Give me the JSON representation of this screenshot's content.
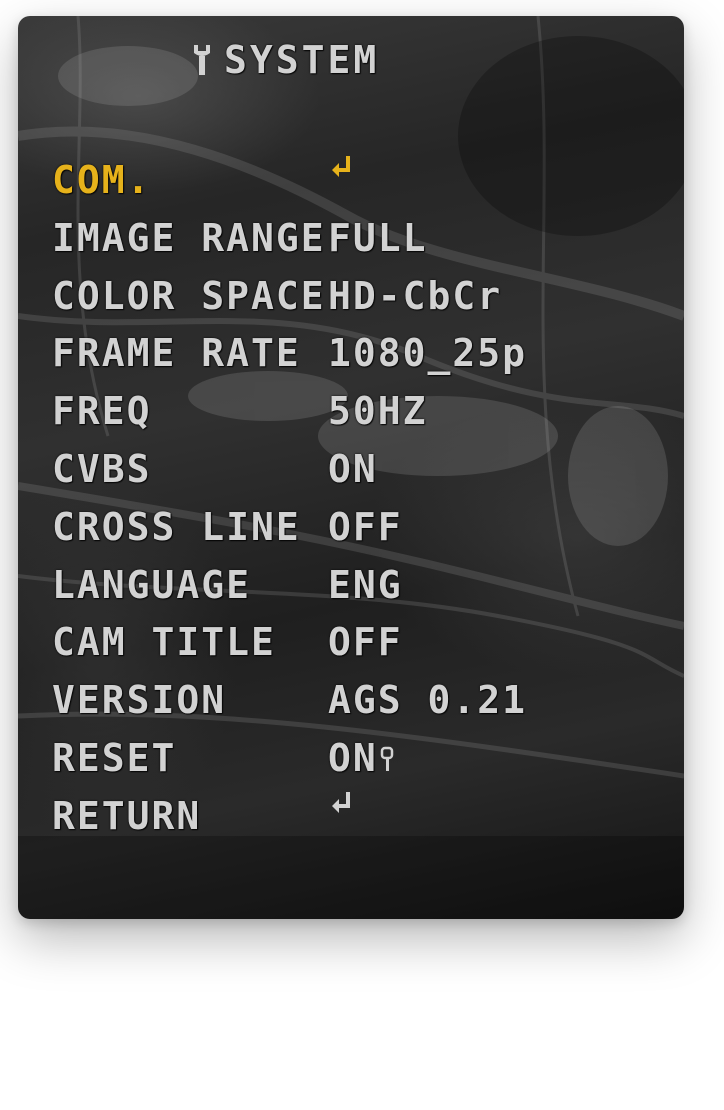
{
  "title": "SYSTEM",
  "icons": {
    "title": "wrench-icon",
    "enter": "enter-arrow-icon",
    "key": "key-icon"
  },
  "colors": {
    "text": "#d2d2d2",
    "selected": "#e6b21b"
  },
  "menu": [
    {
      "label": "COM.",
      "value": "",
      "icon": "enter",
      "selected": true
    },
    {
      "label": "IMAGE RANGE",
      "value": "FULL"
    },
    {
      "label": "COLOR SPACE",
      "value": "HD-CbCr"
    },
    {
      "label": "FRAME RATE",
      "value": "1080_25p"
    },
    {
      "label": "FREQ",
      "value": "50HZ"
    },
    {
      "label": "CVBS",
      "value": "ON"
    },
    {
      "label": "CROSS LINE",
      "value": "OFF"
    },
    {
      "label": "LANGUAGE",
      "value": "ENG"
    },
    {
      "label": "CAM TITLE",
      "value": "OFF"
    },
    {
      "label": "VERSION",
      "value": "AGS 0.21"
    },
    {
      "label": "RESET",
      "value": "ON",
      "icon": "key"
    },
    {
      "label": "RETURN",
      "value": "",
      "icon": "enter"
    }
  ]
}
